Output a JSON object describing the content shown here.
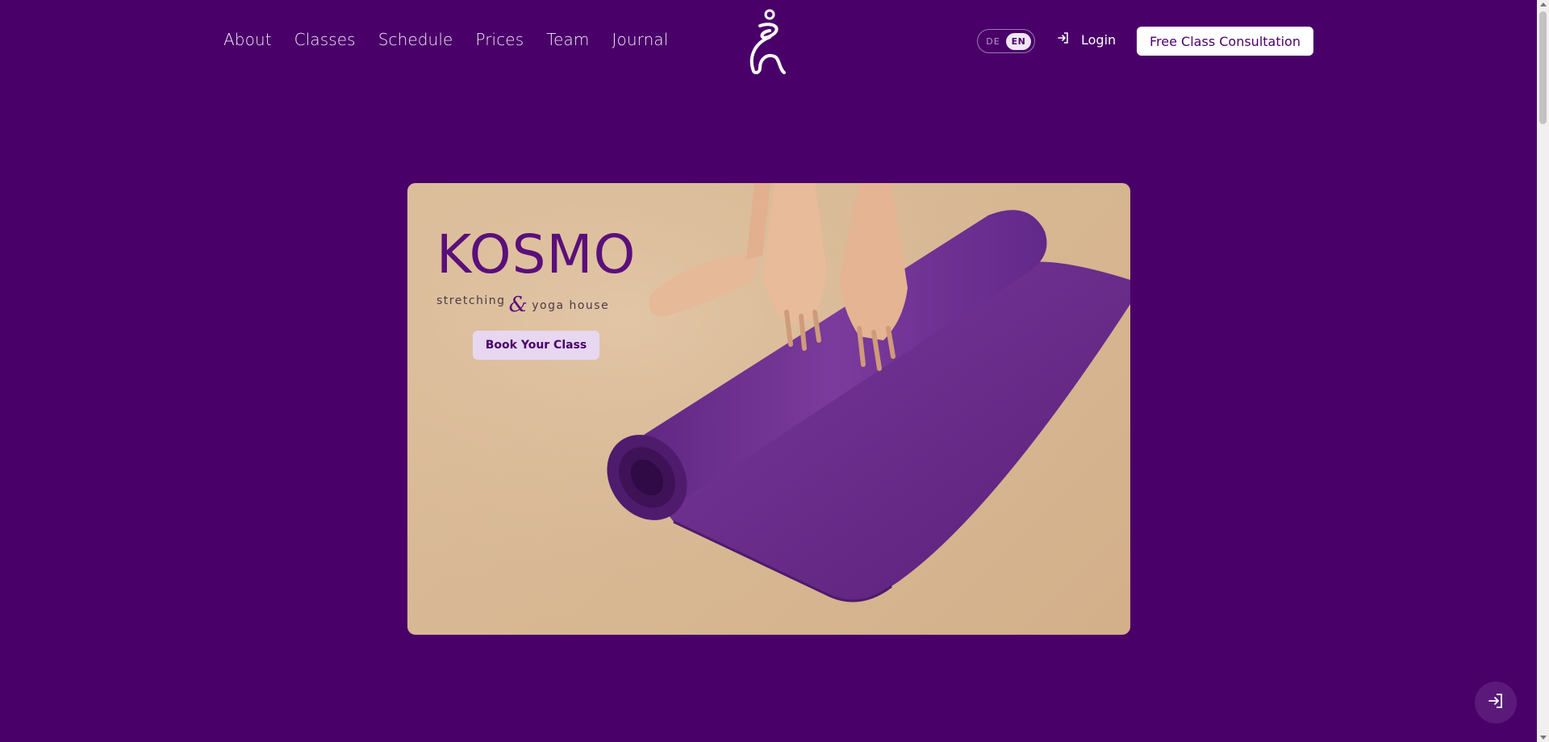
{
  "nav": {
    "items": [
      {
        "label": "About"
      },
      {
        "label": "Classes"
      },
      {
        "label": "Schedule"
      },
      {
        "label": "Prices"
      },
      {
        "label": "Team"
      },
      {
        "label": "Journal"
      }
    ]
  },
  "header": {
    "logo_icon": "kosmo-figure-logo",
    "language": {
      "options": [
        "DE",
        "EN"
      ],
      "selected": "EN"
    },
    "login_label": "Login",
    "login_icon": "login-arrow-icon",
    "cta_label": "Free Class Consultation"
  },
  "hero": {
    "brand_title": "KOSMO",
    "brand_sub_1": "stretching",
    "brand_amp": "&",
    "brand_sub_2": "yoga house",
    "book_label": "Book Your Class",
    "image": "hands rolling purple yoga mat on beige floor"
  },
  "floating": {
    "icon": "login-arrow-icon"
  },
  "colors": {
    "background": "#4a0069",
    "accent": "#5a0f7a",
    "button_light": "#e7d7f0",
    "mat": "#6a2a8a",
    "floor": "#d8b894"
  }
}
